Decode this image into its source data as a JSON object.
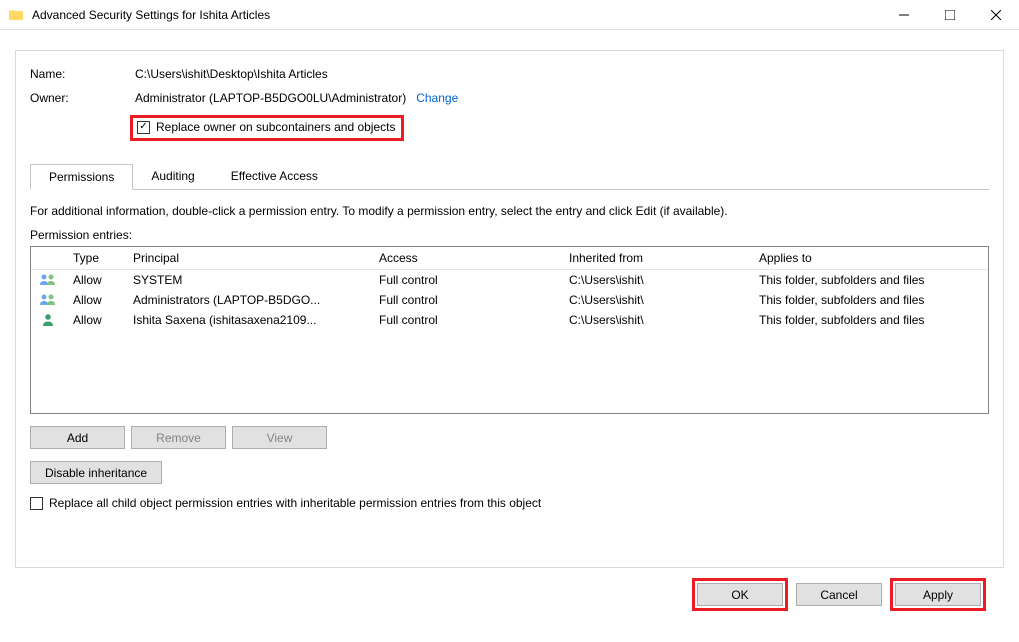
{
  "window": {
    "title": "Advanced Security Settings for Ishita Articles"
  },
  "name_label": "Name:",
  "name_value": "C:\\Users\\ishit\\Desktop\\Ishita Articles",
  "owner_label": "Owner:",
  "owner_value": "Administrator (LAPTOP-B5DGO0LU\\Administrator)",
  "change_link": "Change",
  "replace_owner_label": "Replace owner on subcontainers and objects",
  "tabs": {
    "permissions": "Permissions",
    "auditing": "Auditing",
    "effective": "Effective Access"
  },
  "info_text": "For additional information, double-click a permission entry. To modify a permission entry, select the entry and click Edit (if available).",
  "entries_label": "Permission entries:",
  "columns": {
    "type": "Type",
    "principal": "Principal",
    "access": "Access",
    "inherited": "Inherited from",
    "applies": "Applies to"
  },
  "rows": [
    {
      "type": "Allow",
      "principal": "SYSTEM",
      "access": "Full control",
      "inherited": "C:\\Users\\ishit\\",
      "applies": "This folder, subfolders and files",
      "icon": "group"
    },
    {
      "type": "Allow",
      "principal": "Administrators (LAPTOP-B5DGO...",
      "access": "Full control",
      "inherited": "C:\\Users\\ishit\\",
      "applies": "This folder, subfolders and files",
      "icon": "group"
    },
    {
      "type": "Allow",
      "principal": "Ishita Saxena (ishitasaxena2109...",
      "access": "Full control",
      "inherited": "C:\\Users\\ishit\\",
      "applies": "This folder, subfolders and files",
      "icon": "user"
    }
  ],
  "buttons": {
    "add": "Add",
    "remove": "Remove",
    "view": "View",
    "disable_inheritance": "Disable inheritance",
    "ok": "OK",
    "cancel": "Cancel",
    "apply": "Apply"
  },
  "replace_child_label": "Replace all child object permission entries with inheritable permission entries from this object"
}
